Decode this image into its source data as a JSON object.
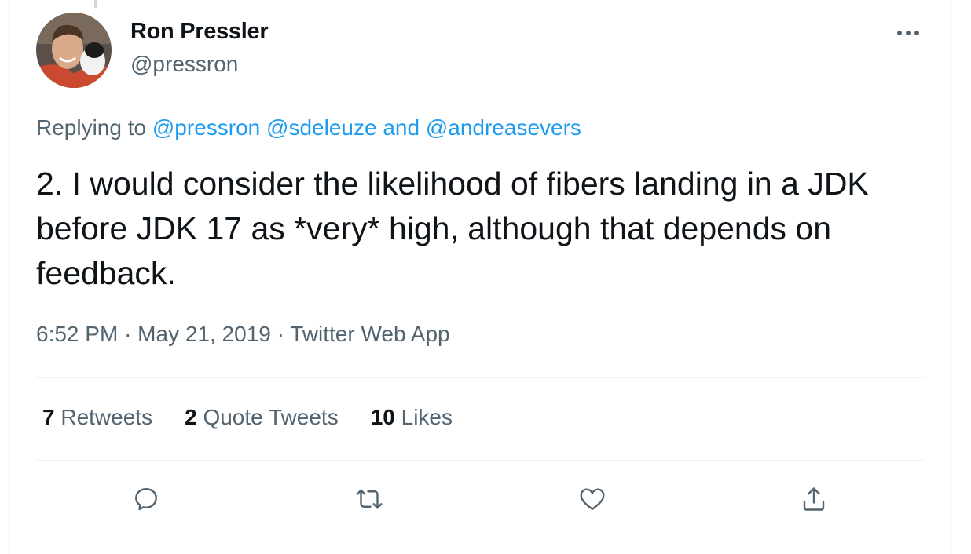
{
  "tweet": {
    "author_name": "Ron Pressler",
    "author_handle": "@pressron",
    "more_icon": "ellipsis-icon",
    "replying_prefix": "Replying to",
    "replying_mention_1": "@pressron",
    "replying_mention_2": "@sdeleuze",
    "replying_and": "and",
    "replying_mention_3": "@andreasevers",
    "text": "2. I would consider the likelihood of fibers landing in a JDK before JDK 17 as *very* high, although that depends on feedback.",
    "time": "6:52 PM",
    "separator": "·",
    "date": "May 21, 2019",
    "source": "Twitter Web App"
  },
  "stats": {
    "retweets_count": "7",
    "retweets_label": "Retweets",
    "quotes_count": "2",
    "quotes_label": "Quote Tweets",
    "likes_count": "10",
    "likes_label": "Likes"
  },
  "actions": [
    "reply-icon",
    "retweet-icon",
    "like-icon",
    "share-icon"
  ],
  "colors": {
    "text": "#0f1419",
    "secondary": "#536471",
    "link": "#1d9bf0",
    "divider": "#eff3f4"
  }
}
